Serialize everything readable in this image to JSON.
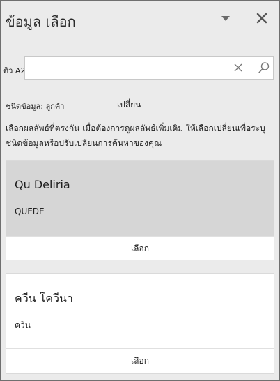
{
  "header": {
    "title": "ข้อมูล  เลือก",
    "dropdown_icon": "chevron-down-icon",
    "close_icon": "close-icon"
  },
  "search": {
    "label": "ดิว A2",
    "value": "",
    "clear_icon": "clear-icon",
    "search_icon": "search-icon"
  },
  "data_type": {
    "label": "ชนิดข้อมูล: ลูกค้า",
    "change_label": "เปลี่ยน"
  },
  "instructions": "เลือกผลลัพธ์ที่ตรงกัน เมื่อต้องการดูผลลัพธ์เพิ่มเติม ให้เลือกเปลี่ยนเพื่อระบุชนิดข้อมูลหรือปรับเปลี่ยนการค้นหาของคุณ",
  "results": [
    {
      "title": "Qu Deliria",
      "subtitle": "QUEDE",
      "select_label": "เลือก",
      "highlighted": true
    },
    {
      "title": "ควีน โควีนา",
      "subtitle": "ควิน",
      "select_label": "เลือก",
      "highlighted": false
    }
  ],
  "colors": {
    "pane_bg": "#ebebeb",
    "highlight_bg": "#d6d6d6",
    "card_bg": "#ffffff",
    "border": "#6f6f6f"
  }
}
